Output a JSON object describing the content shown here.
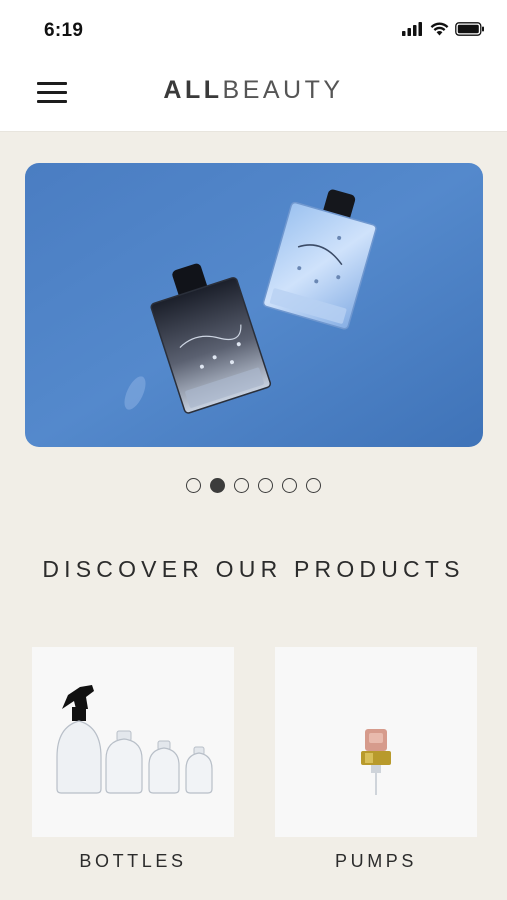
{
  "status_bar": {
    "time": "6:19",
    "icons": [
      "cellular-signal-icon",
      "wifi-icon",
      "battery-icon"
    ]
  },
  "header": {
    "menu_icon": "hamburger-menu-icon",
    "brand_bold": "ALL",
    "brand_light": "BEAUTY"
  },
  "carousel": {
    "slide_count": 6,
    "active_index": 1
  },
  "section": {
    "title": "DISCOVER OUR PRODUCTS"
  },
  "products": [
    {
      "label": "BOTTLES"
    },
    {
      "label": "PUMPS"
    }
  ],
  "colors": {
    "background": "#f1eee7",
    "banner_blue": "#4b7fc4",
    "text": "#2b2b2b"
  }
}
